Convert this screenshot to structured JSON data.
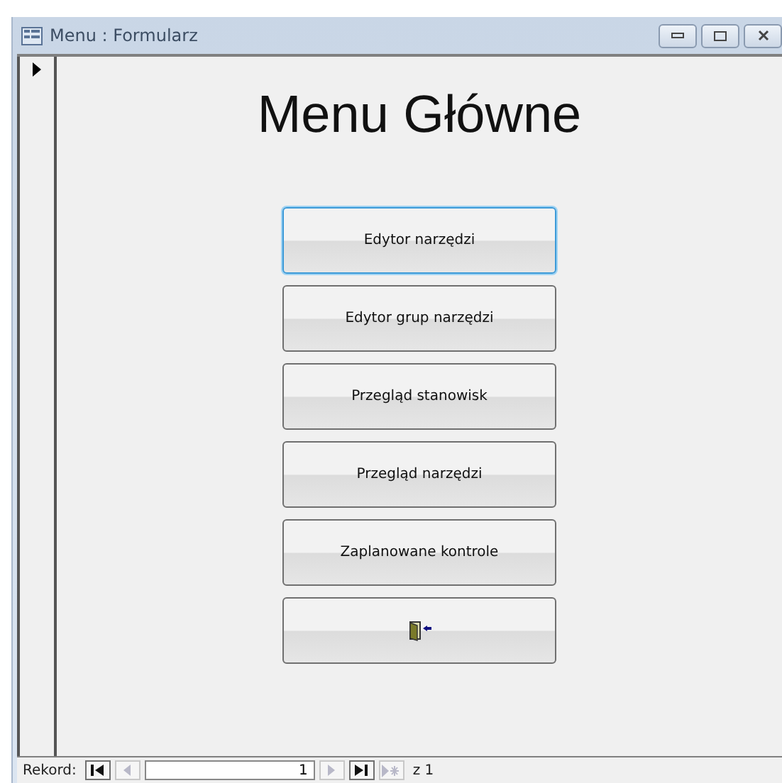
{
  "window": {
    "title": "Menu : Formularz"
  },
  "heading": "Menu Główne",
  "buttons": [
    {
      "kind": "text",
      "label": "Edytor narzędzi",
      "focused": true
    },
    {
      "kind": "text",
      "label": "Edytor grup narzędzi",
      "focused": false
    },
    {
      "kind": "text",
      "label": "Przegląd stanowisk",
      "focused": false
    },
    {
      "kind": "text",
      "label": "Przegląd narzędzi",
      "focused": false
    },
    {
      "kind": "text",
      "label": "Zaplanowane kontrole",
      "focused": false
    },
    {
      "kind": "exit",
      "focused": false
    }
  ],
  "navigation": {
    "label": "Rekord:",
    "record": "1",
    "total": "z 1",
    "buttons": [
      {
        "kind": "first",
        "disabled": false
      },
      {
        "kind": "prev",
        "disabled": true
      },
      {
        "kind": "next",
        "disabled": true
      },
      {
        "kind": "last",
        "disabled": false
      },
      {
        "kind": "new",
        "disabled": true
      }
    ]
  }
}
